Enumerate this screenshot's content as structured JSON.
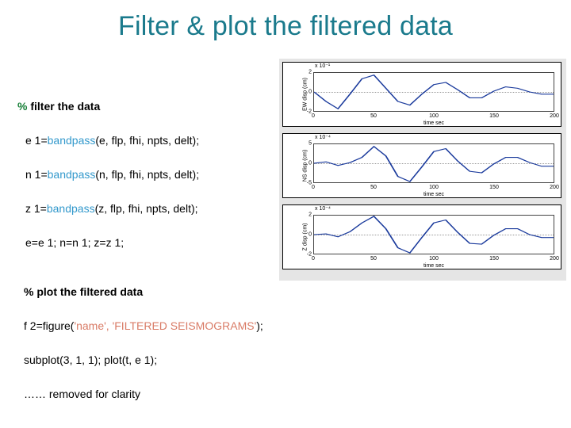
{
  "title": "Filter & plot the filtered data",
  "code": {
    "comment1_pct": "%",
    "comment1_rest": " filter the data",
    "line_e1_a": "e 1=",
    "line_e1_fn": "bandpass",
    "line_e1_b": "(e, flp, fhi, npts, delt);",
    "line_n1_a": "n 1=",
    "line_n1_fn": "bandpass",
    "line_n1_b": "(n, flp, fhi, npts, delt);",
    "line_z1_a": "z 1=",
    "line_z1_fn": "bandpass",
    "line_z1_b": "(z, flp, fhi, npts, delt);",
    "line_assign": "e=e 1; n=n 1;  z=z 1;",
    "comment2": "% plot the filtered data",
    "line_fig_a": "f 2=figure(",
    "line_fig_str": "'name', 'FILTERED SEISMOGRAMS'",
    "line_fig_b": ");",
    "line_subplot": "subplot(3, 1, 1); plot(t, e 1);",
    "line_removed": "……  removed for clarity"
  },
  "charts": {
    "xlabel": "time sec",
    "xticks": [
      "0",
      "50",
      "100",
      "150",
      "200"
    ],
    "panels": [
      {
        "ylabel": "EW disp (cm)",
        "exp": "x 10⁻¹",
        "ymin": -2,
        "ymax": 2,
        "yticks": [
          "-2",
          "0",
          "2"
        ]
      },
      {
        "ylabel": "NS disp (cm)",
        "exp": "x 10⁻⁴",
        "ymin": -5,
        "ymax": 5,
        "yticks": [
          "-5",
          "0",
          "5"
        ]
      },
      {
        "ylabel": "Z disp (cm)",
        "exp": "x 10⁻⁴",
        "ymin": -2,
        "ymax": 2,
        "yticks": [
          "-2",
          "0",
          "2"
        ]
      }
    ]
  },
  "chart_data": [
    {
      "type": "line",
      "title": "",
      "xlabel": "time sec",
      "ylabel": "EW disp (cm)",
      "xlim": [
        0,
        200
      ],
      "ylim": [
        -2,
        2
      ],
      "exp": "x 10^-1",
      "series": [
        {
          "name": "e1",
          "x": [
            0,
            10,
            20,
            30,
            40,
            50,
            60,
            70,
            80,
            90,
            100,
            110,
            120,
            130,
            140,
            150,
            160,
            170,
            180,
            190,
            200
          ],
          "values": [
            0,
            -1.0,
            -1.8,
            -0.2,
            1.4,
            1.8,
            0.4,
            -1.0,
            -1.4,
            -0.2,
            0.8,
            1.0,
            0.2,
            -0.6,
            -0.6,
            0.1,
            0.5,
            0.4,
            0.0,
            -0.2,
            -0.2
          ]
        }
      ]
    },
    {
      "type": "line",
      "title": "",
      "xlabel": "time sec",
      "ylabel": "NS disp (cm)",
      "xlim": [
        0,
        200
      ],
      "ylim": [
        -5,
        5
      ],
      "exp": "x 10^-4",
      "series": [
        {
          "name": "n1",
          "x": [
            0,
            10,
            20,
            30,
            40,
            50,
            60,
            70,
            80,
            90,
            100,
            110,
            120,
            130,
            140,
            150,
            160,
            170,
            180,
            190,
            200
          ],
          "values": [
            0,
            0.3,
            -0.5,
            0.2,
            1.5,
            4.5,
            2.0,
            -3.5,
            -4.8,
            -1.0,
            3.0,
            3.8,
            0.5,
            -2.2,
            -2.5,
            -0.2,
            1.5,
            1.6,
            0.2,
            -0.8,
            -0.8
          ]
        }
      ]
    },
    {
      "type": "line",
      "title": "",
      "xlabel": "time sec",
      "ylabel": "Z disp (cm)",
      "xlim": [
        0,
        200
      ],
      "ylim": [
        -2,
        2
      ],
      "exp": "x 10^-4",
      "series": [
        {
          "name": "z1",
          "x": [
            0,
            10,
            20,
            30,
            40,
            50,
            60,
            70,
            80,
            90,
            100,
            110,
            120,
            130,
            140,
            150,
            160,
            170,
            180,
            190,
            200
          ],
          "values": [
            0,
            0.1,
            -0.2,
            0.3,
            1.2,
            1.9,
            0.6,
            -1.4,
            -1.9,
            -0.3,
            1.2,
            1.5,
            0.2,
            -0.9,
            -1.0,
            -0.1,
            0.6,
            0.6,
            0.0,
            -0.3,
            -0.3
          ]
        }
      ]
    }
  ]
}
